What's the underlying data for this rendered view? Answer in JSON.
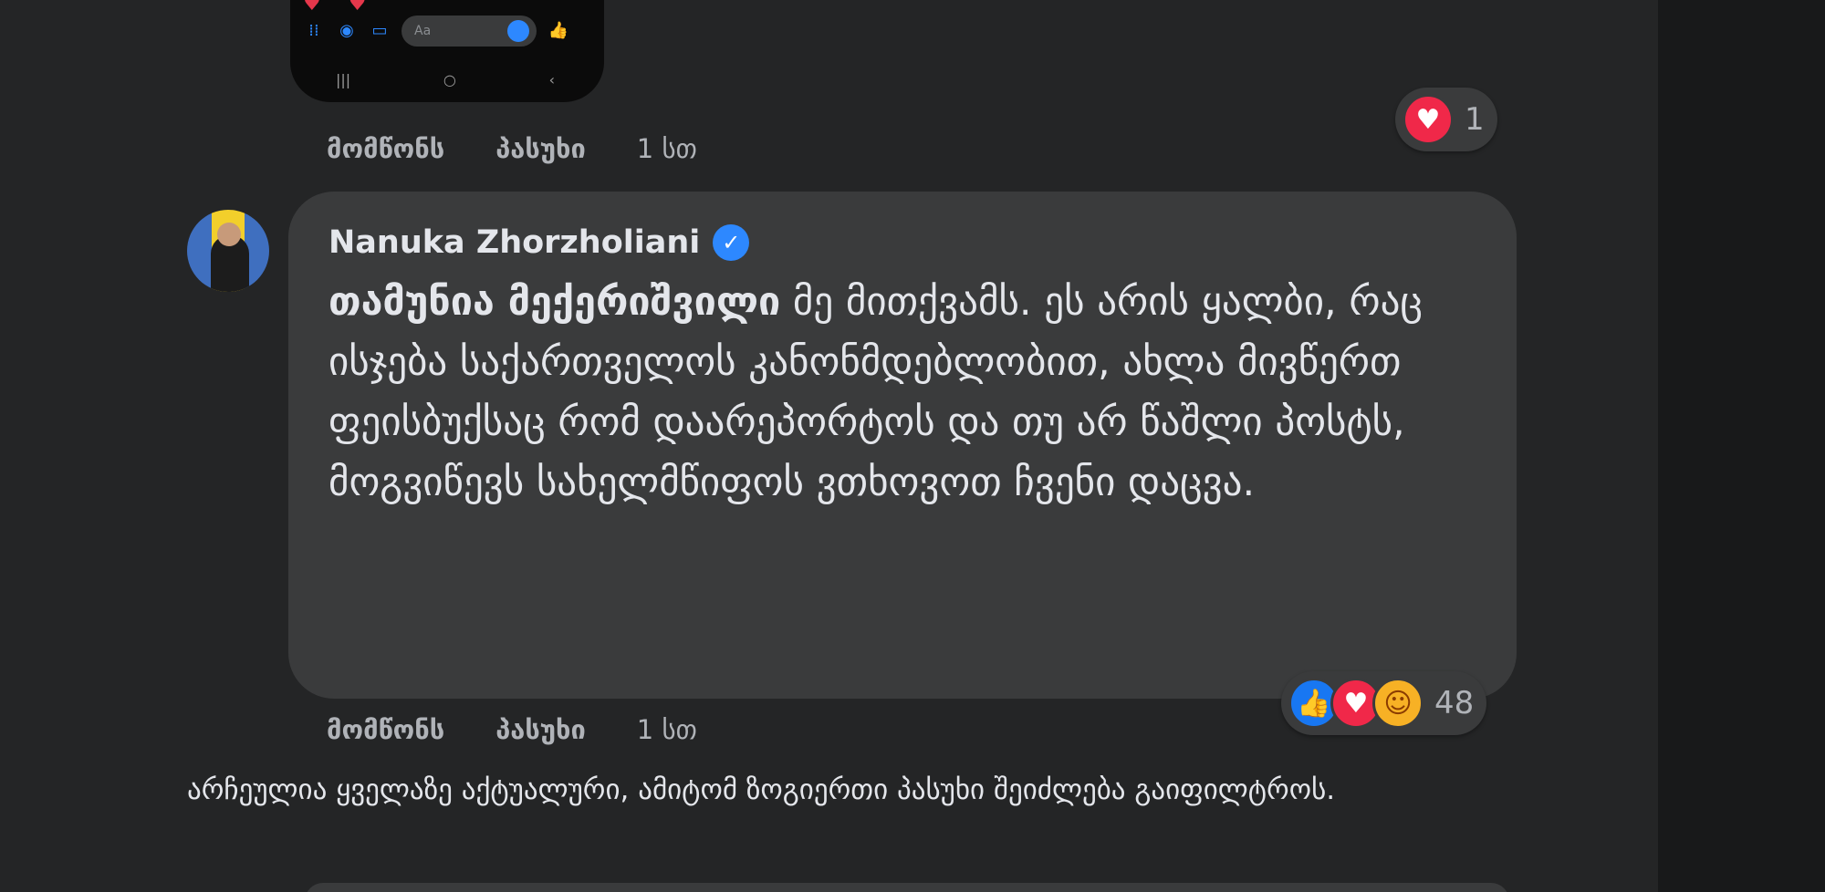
{
  "phone_preview": {
    "toolbar_icons": [
      "apps-icon",
      "camera-icon",
      "gallery-icon",
      "emoji-icon",
      "thumbs-up-icon"
    ],
    "input_placeholder": "Aa",
    "nav_icons": [
      "recent-apps-icon",
      "home-icon",
      "back-icon"
    ]
  },
  "comment1": {
    "like_label": "მომწონს",
    "reply_label": "პასუხი",
    "time": "1 სთ",
    "reaction_count": "1",
    "reactions": [
      "love"
    ]
  },
  "comment2": {
    "author": "Nanuka Zhorzholiani",
    "verified": true,
    "mention": "თამუნია მექერიშვილი",
    "text": " მე მითქვამს. ეს არის ყალბი, რაც ისჯება საქართველოს კანონმდებლობით, ახლა მივწერთ ფეისბუქსაც რომ დაარეპორტოს და თუ არ წაშლი პოსტს, მოგვიწევს სახელმწიფოს ვთხოვოთ ჩვენი დაცვა.",
    "like_label": "მომწონს",
    "reply_label": "პასუხი",
    "time": "1 სთ",
    "reaction_count": "48",
    "reactions": [
      "like",
      "love",
      "care"
    ]
  },
  "sort_note": "არჩეულია ყველაზე აქტუალური, ამიტომ ზოგიერთი პასუხი შეიძლება გაიფილტროს.",
  "colors": {
    "background": "#242526",
    "bubble": "#3a3b3c",
    "text": "#e4e6eb",
    "secondary_text": "#b0b3b8",
    "like": "#1877f2",
    "love": "#f02849",
    "care": "#f7b125",
    "verified": "#2d88ff"
  }
}
